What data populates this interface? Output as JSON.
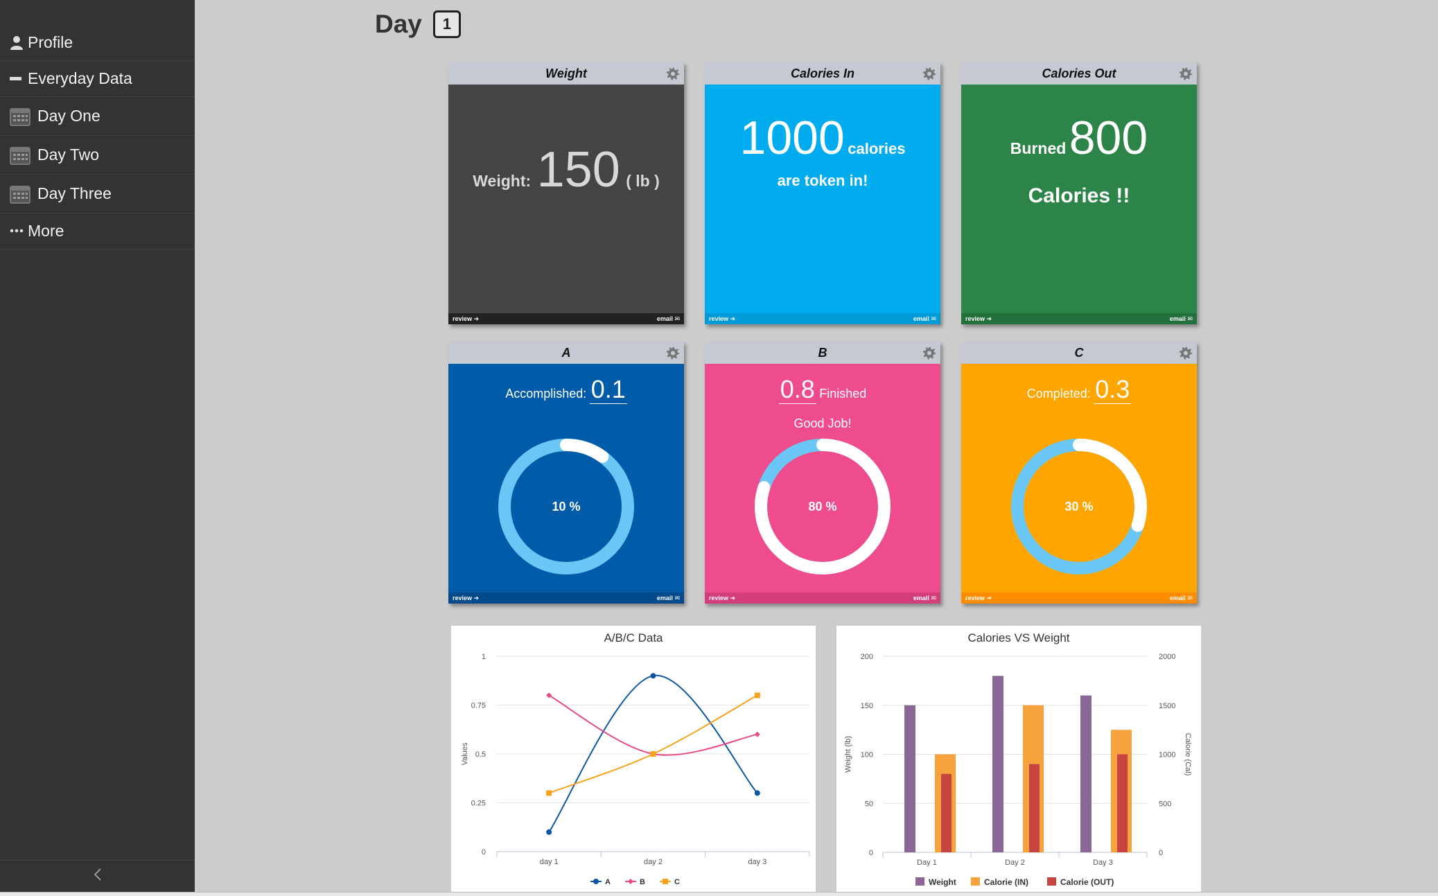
{
  "sidebar": {
    "items": [
      {
        "label": "Profile",
        "icon": "user-icon"
      },
      {
        "label": "Everyday Data",
        "icon": "minus-icon"
      },
      {
        "label": "Day One",
        "icon": "calendar-icon"
      },
      {
        "label": "Day Two",
        "icon": "calendar-icon"
      },
      {
        "label": "Day Three",
        "icon": "calendar-icon"
      },
      {
        "label": "More",
        "icon": "ellipsis-icon"
      }
    ],
    "collapse_icon": "chevron-left-icon"
  },
  "header": {
    "title": "Day",
    "badge": "1"
  },
  "cards": {
    "weight": {
      "title": "Weight",
      "label": "Weight:",
      "value": "150",
      "unit": "( lb )",
      "color": "#444444",
      "footer_color": "#222222",
      "review": "review",
      "email": "email"
    },
    "calories_in": {
      "title": "Calories In",
      "value": "1000",
      "unit": "calories",
      "line2": "are token in!",
      "color": "#00aced",
      "footer_color": "#009ad6",
      "review": "review",
      "email": "email"
    },
    "calories_out": {
      "title": "Calories Out",
      "prefix": "Burned",
      "value": "800",
      "line2": "Calories !!",
      "color": "#2d8449",
      "footer_color": "#22703b",
      "review": "review",
      "email": "email"
    },
    "a": {
      "title": "A",
      "label": "Accomplished:",
      "value": "0.1",
      "progress": 0.1,
      "center": "10 %",
      "color": "#005ba8",
      "footer_color": "#004a8c",
      "review": "review",
      "email": "email"
    },
    "b": {
      "title": "B",
      "value": "0.8",
      "label": "Finished",
      "note": "Good Job!",
      "progress": 0.8,
      "center": "80 %",
      "color": "#ef4c8d",
      "footer_color": "#d33d7a",
      "review": "review",
      "email": "email"
    },
    "c": {
      "title": "C",
      "label": "Completed:",
      "value": "0.3",
      "progress": 0.3,
      "center": "30 %",
      "color": "#ffa500",
      "footer_color": "#ff8c00",
      "review": "review",
      "email": "email"
    }
  },
  "chart_data": [
    {
      "type": "line",
      "title": "A/B/C Data",
      "ylabel": "Values",
      "xlabel": "",
      "categories": [
        "day 1",
        "day 2",
        "day 3"
      ],
      "ylim": [
        0,
        1
      ],
      "yticks": [
        "0",
        "0.25",
        "0.5",
        "0.75",
        "1"
      ],
      "series": [
        {
          "name": "A",
          "values": [
            0.1,
            0.9,
            0.3
          ],
          "color": "#0d56a3"
        },
        {
          "name": "B",
          "values": [
            0.8,
            0.5,
            0.6
          ],
          "color": "#e84a86"
        },
        {
          "name": "C",
          "values": [
            0.3,
            0.5,
            0.8
          ],
          "color": "#f7a21b"
        }
      ],
      "legend": "bottom-center",
      "grid": true
    },
    {
      "type": "bar",
      "title": "Calories VS Weight",
      "ylabel": "Weight (lb)",
      "y2label": "Calorie (Cal)",
      "categories": [
        "Day 1",
        "Day 2",
        "Day 3"
      ],
      "ylim": [
        0,
        200
      ],
      "y2lim": [
        0,
        2000
      ],
      "yticks": [
        "0",
        "50",
        "100",
        "150",
        "200"
      ],
      "y2ticks": [
        "0",
        "500",
        "1000",
        "1500",
        "2000"
      ],
      "series": [
        {
          "name": "Weight",
          "values": [
            150,
            180,
            160
          ],
          "axis": "left",
          "color": "#8a6797"
        },
        {
          "name": "Calorie (IN)",
          "values": [
            1000,
            1500,
            1250
          ],
          "axis": "right",
          "color": "#f6a33e"
        },
        {
          "name": "Calorie (OUT)",
          "values": [
            800,
            900,
            1000
          ],
          "axis": "right",
          "color": "#c64541"
        }
      ],
      "legend": "bottom-center",
      "grid": true
    }
  ]
}
